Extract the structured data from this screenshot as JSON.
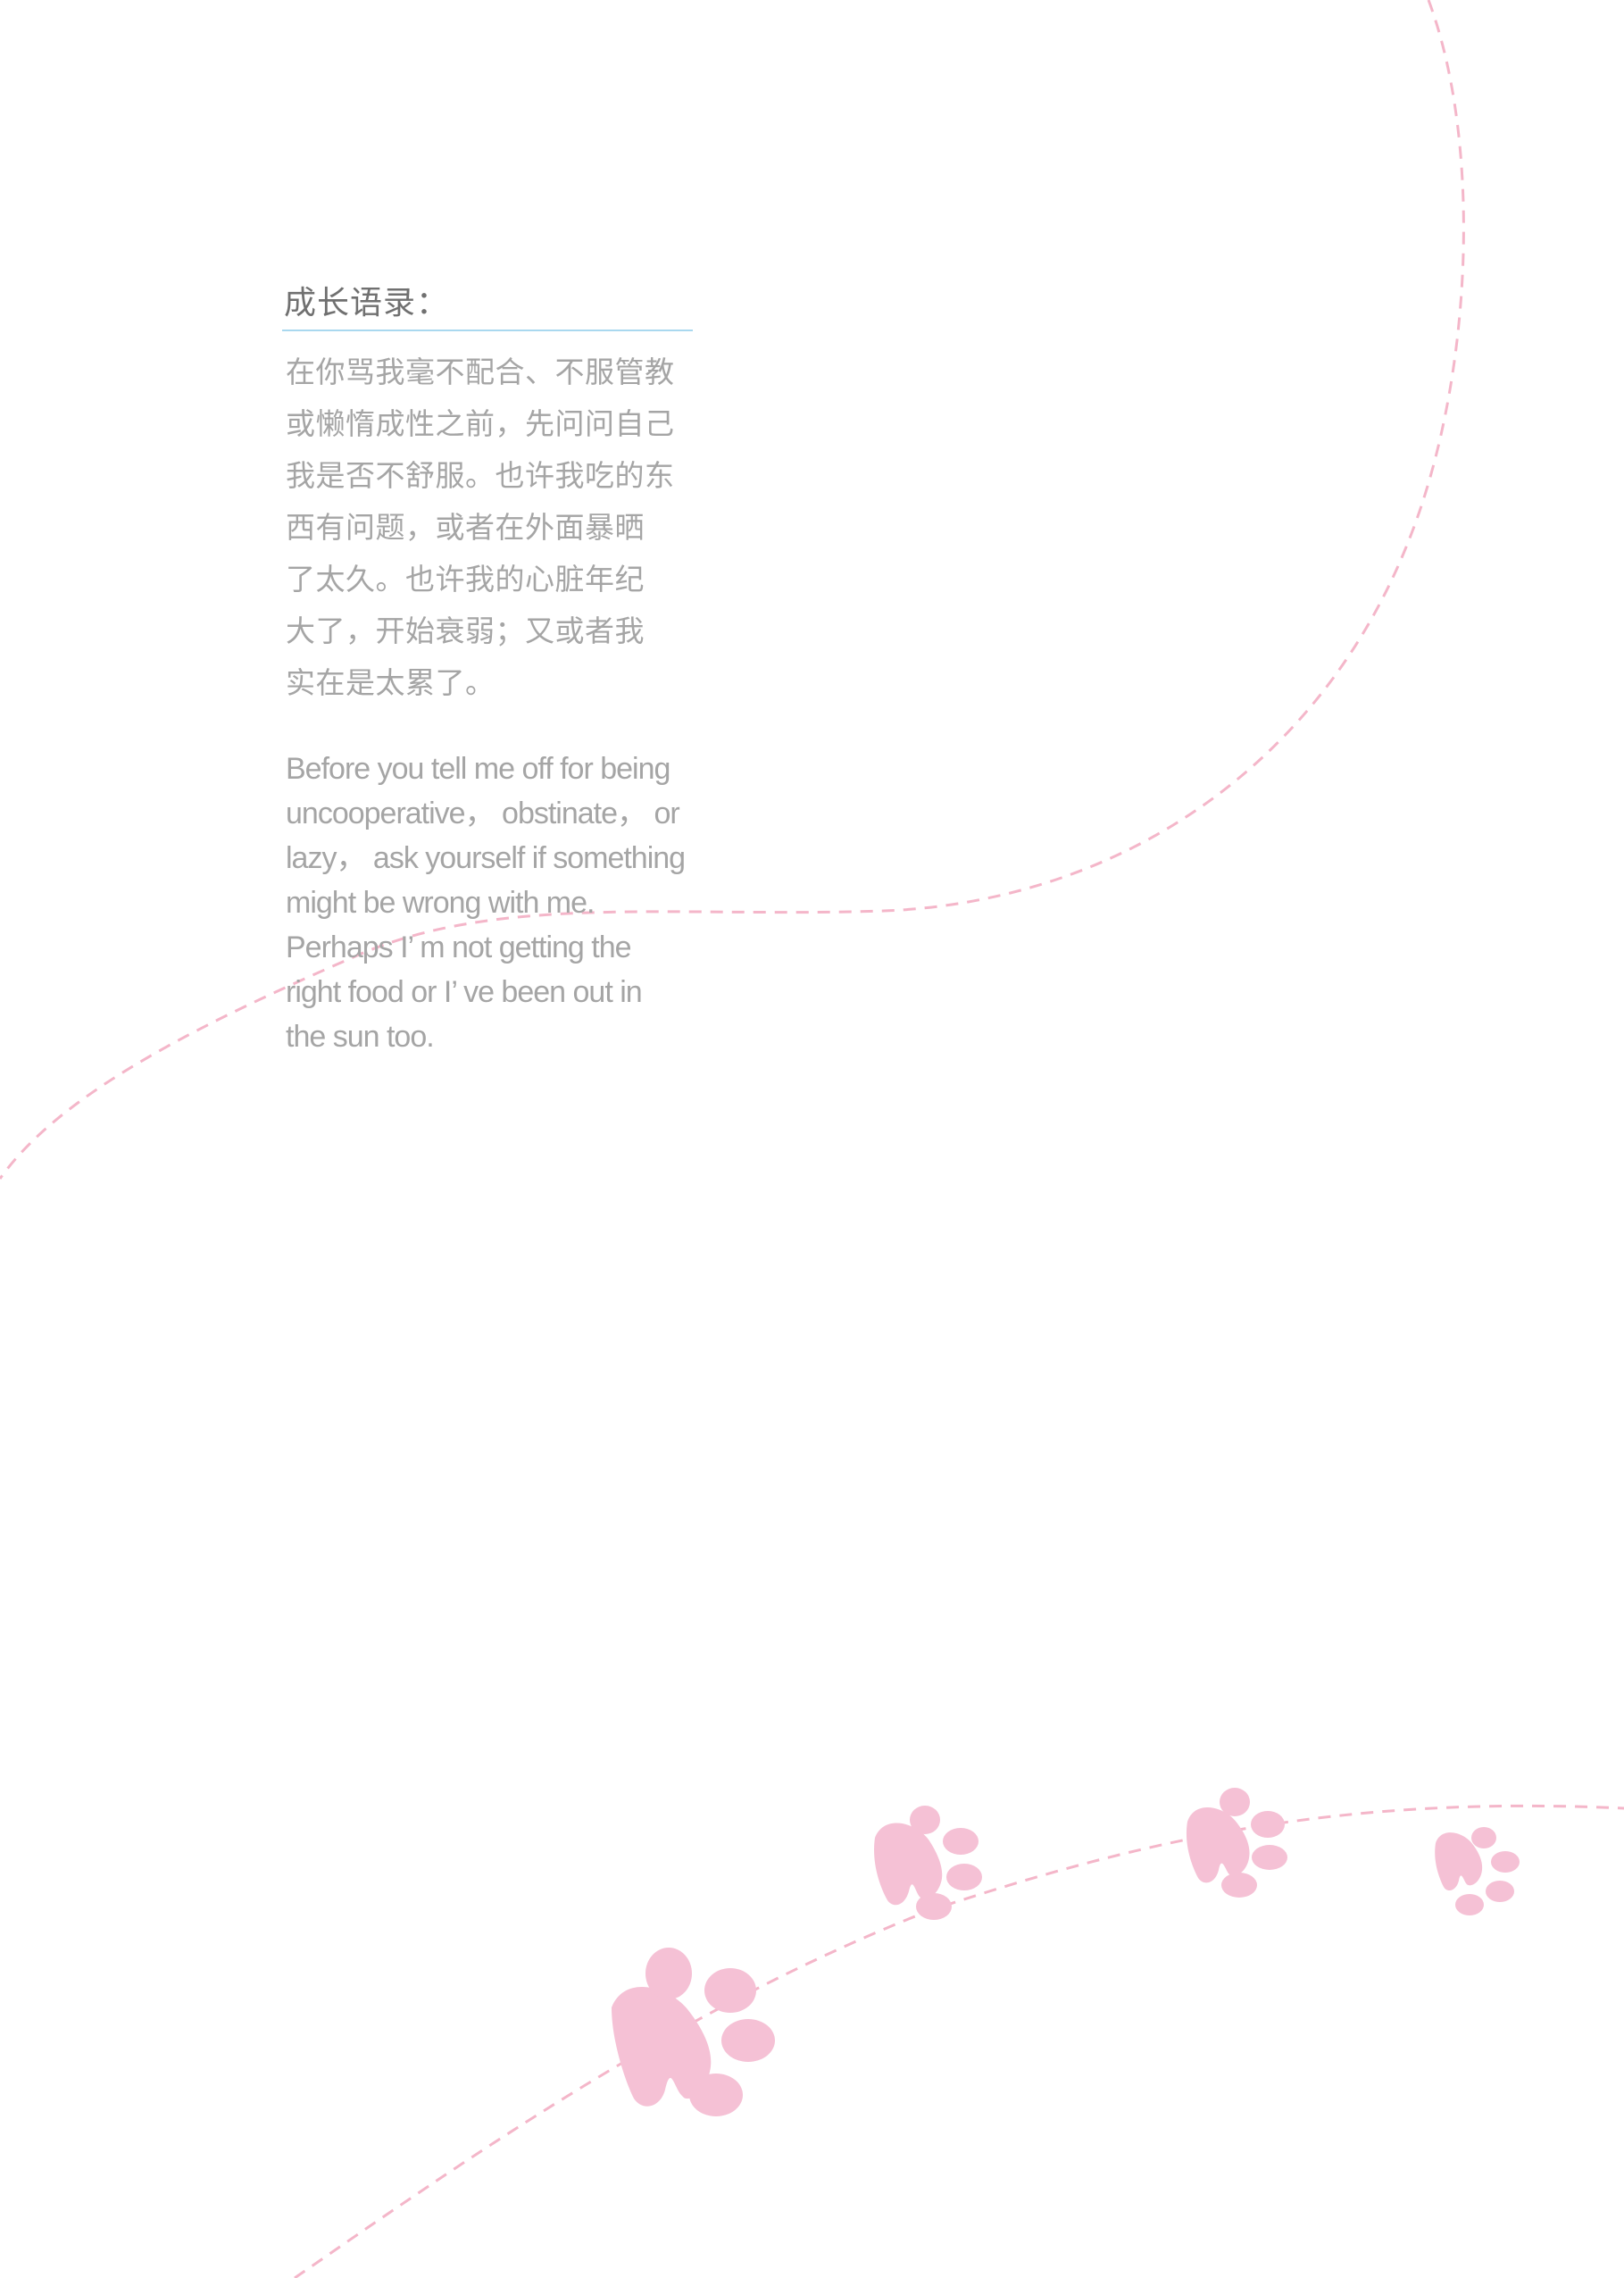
{
  "colors": {
    "trail": "#f4b6c9",
    "paw": "#f5c1d5",
    "text": "#a5a5a5",
    "heading": "#707070",
    "rule": "#a9d8ef"
  },
  "section": {
    "heading": "成长语录："
  },
  "chinese_lines": [
    "在你骂我毫不配合、不服管教",
    "或懒惰成性之前，先问问自己",
    "我是否不舒服。也许我吃的东",
    "西有问题，或者在外面暴晒",
    "了太久。也许我的心脏年纪",
    "大了，开始衰弱；又或者我",
    "实在是太累了。"
  ],
  "english_lines": [
    "Before you tell me off for being",
    "uncooperative， obstinate， or",
    "lazy， ask yourself if something",
    "might be wrong with me.",
    "Perhaps I’ m not getting the",
    "right food or I’ ve been out in",
    "the sun too."
  ],
  "icons": [
    "dashed-trail",
    "paw-print-icon"
  ]
}
